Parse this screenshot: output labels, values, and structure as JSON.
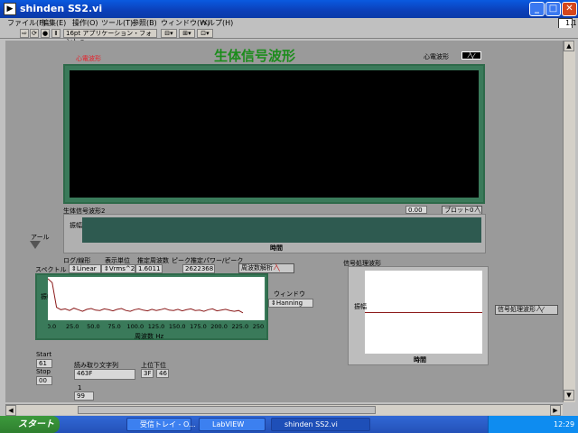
{
  "window": {
    "title": "shinden SS2.vi"
  },
  "menu": [
    "ファイル(F)",
    "編集(E)",
    "操作(O)",
    "ツール(T)",
    "参照(B)",
    "ウィンドウ(W)",
    "ヘルプ(H)"
  ],
  "toolbar": {
    "font_select": "16pt アプリケーション・フォント",
    "run_mode": "1.1"
  },
  "panel": {
    "main_title": "生体信号波形",
    "ecg_chart_label": "心電波形",
    "ecg_legend": "心電波形",
    "waveform2_label": "生体信号波形2",
    "waveform2_value": "0.00",
    "plot_legend": "プロット0",
    "waveform2_ylabel": "振幅",
    "waveform2_xlabel": "時間",
    "alarm_label": "アール",
    "log_linear_label": "ログ/線形",
    "display_unit_label": "表示単位",
    "est_freq_label": "推定周波数",
    "peak_label": "ピーク推定パワー/ピーク",
    "spectrum_label": "スペクトル",
    "log_linear_value": "Linear",
    "unit_value": "Vrms^2",
    "freq_value": "1.6011",
    "peak_value": "2622368",
    "fft_legend": "周波数解析",
    "fft_ylabel": "振幅",
    "fft_xlabel": "周波数 Hz",
    "window_label": "ウィンドウ",
    "window_value": "Hanning",
    "sig_proc_label": "信号処理波形",
    "sig_proc_ylabel": "振幅",
    "sig_proc_xlabel": "時間",
    "sig_proc_legend": "信号処理波形",
    "start_label": "Start",
    "start_value": "61",
    "stop_label": "Stop",
    "stop_value": "00",
    "read_label": "読み取り文字列",
    "read_value": "463F",
    "upper_lower_label": "上位下位",
    "upper_value": "3F",
    "lower_value": "46",
    "idx_label": "1",
    "idx_value": "99"
  },
  "chart_data": {
    "type": "line",
    "xlabel": "周波数 Hz",
    "ylabel": "振幅",
    "xlim": [
      0,
      250
    ],
    "x_ticks": [
      "0.0",
      "25.0",
      "50.0",
      "75.0",
      "100.0",
      "125.0",
      "150.0",
      "175.0",
      "200.0",
      "225.0",
      "250.0"
    ],
    "y_ticks": [],
    "series": [
      {
        "color": "#8b1a1a",
        "x": [
          0,
          5,
          10,
          15,
          20,
          25,
          30,
          35,
          40,
          45,
          50,
          55,
          60,
          65,
          70,
          75,
          80,
          85,
          90,
          95,
          100,
          105,
          110,
          115,
          120,
          125,
          130,
          135,
          140,
          145,
          150,
          155,
          160,
          165,
          170,
          175,
          180,
          185,
          190,
          195,
          200,
          205,
          210,
          215,
          220,
          225
        ],
        "y": [
          1.0,
          0.9,
          0.28,
          0.22,
          0.24,
          0.2,
          0.26,
          0.22,
          0.18,
          0.23,
          0.25,
          0.21,
          0.2,
          0.24,
          0.22,
          0.19,
          0.23,
          0.25,
          0.2,
          0.18,
          0.22,
          0.24,
          0.21,
          0.19,
          0.23,
          0.2,
          0.22,
          0.25,
          0.21,
          0.2,
          0.23,
          0.19,
          0.22,
          0.24,
          0.2,
          0.21,
          0.18,
          0.22,
          0.24,
          0.19,
          0.21,
          0.23,
          0.2,
          0.18,
          0.2,
          0.14
        ]
      }
    ]
  },
  "taskbar": {
    "start": "スタート",
    "tasks": [
      "受信トレイ - O...",
      "LabVIEW",
      "shinden SS2.vi"
    ],
    "clock": "12:29"
  }
}
